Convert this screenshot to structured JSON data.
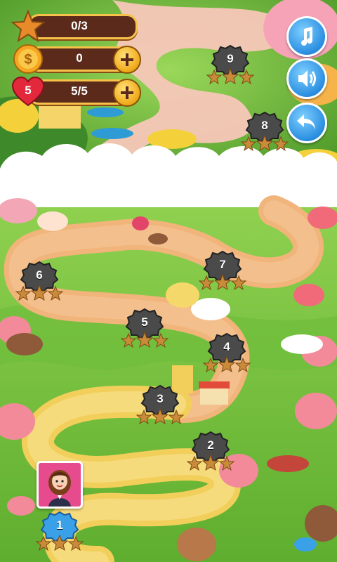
{
  "hud": {
    "stars_value": "0/3",
    "coins_value": "0",
    "lives_count": "5",
    "lives_value": "5/5"
  },
  "buttons": {
    "music": "music-icon",
    "sound": "speaker-icon",
    "back": "back-arrow-icon"
  },
  "levels": [
    {
      "number": "1",
      "state": "current",
      "color": "#3aa0e8",
      "stars": 0
    },
    {
      "number": "2",
      "state": "locked",
      "color": "#4a4a4a",
      "stars": 0
    },
    {
      "number": "3",
      "state": "locked",
      "color": "#4a4a4a",
      "stars": 0
    },
    {
      "number": "4",
      "state": "locked",
      "color": "#4a4a4a",
      "stars": 0
    },
    {
      "number": "5",
      "state": "locked",
      "color": "#4a4a4a",
      "stars": 0
    },
    {
      "number": "6",
      "state": "locked",
      "color": "#4a4a4a",
      "stars": 0
    },
    {
      "number": "7",
      "state": "locked",
      "color": "#4a4a4a",
      "stars": 0
    },
    {
      "number": "8",
      "state": "locked",
      "color": "#4a4a4a",
      "stars": 0
    },
    {
      "number": "9",
      "state": "locked",
      "color": "#4a4a4a",
      "stars": 0
    }
  ],
  "colors": {
    "grass": "#7cc243",
    "path": "#f1b47a",
    "yellow_path": "#f5d86a",
    "cloud": "#ffffff",
    "hud_bar": "#5b2a1a",
    "hud_border": "#f6c24a",
    "button_blue": "#2a8ee0",
    "star_empty": "#c98a3a"
  }
}
